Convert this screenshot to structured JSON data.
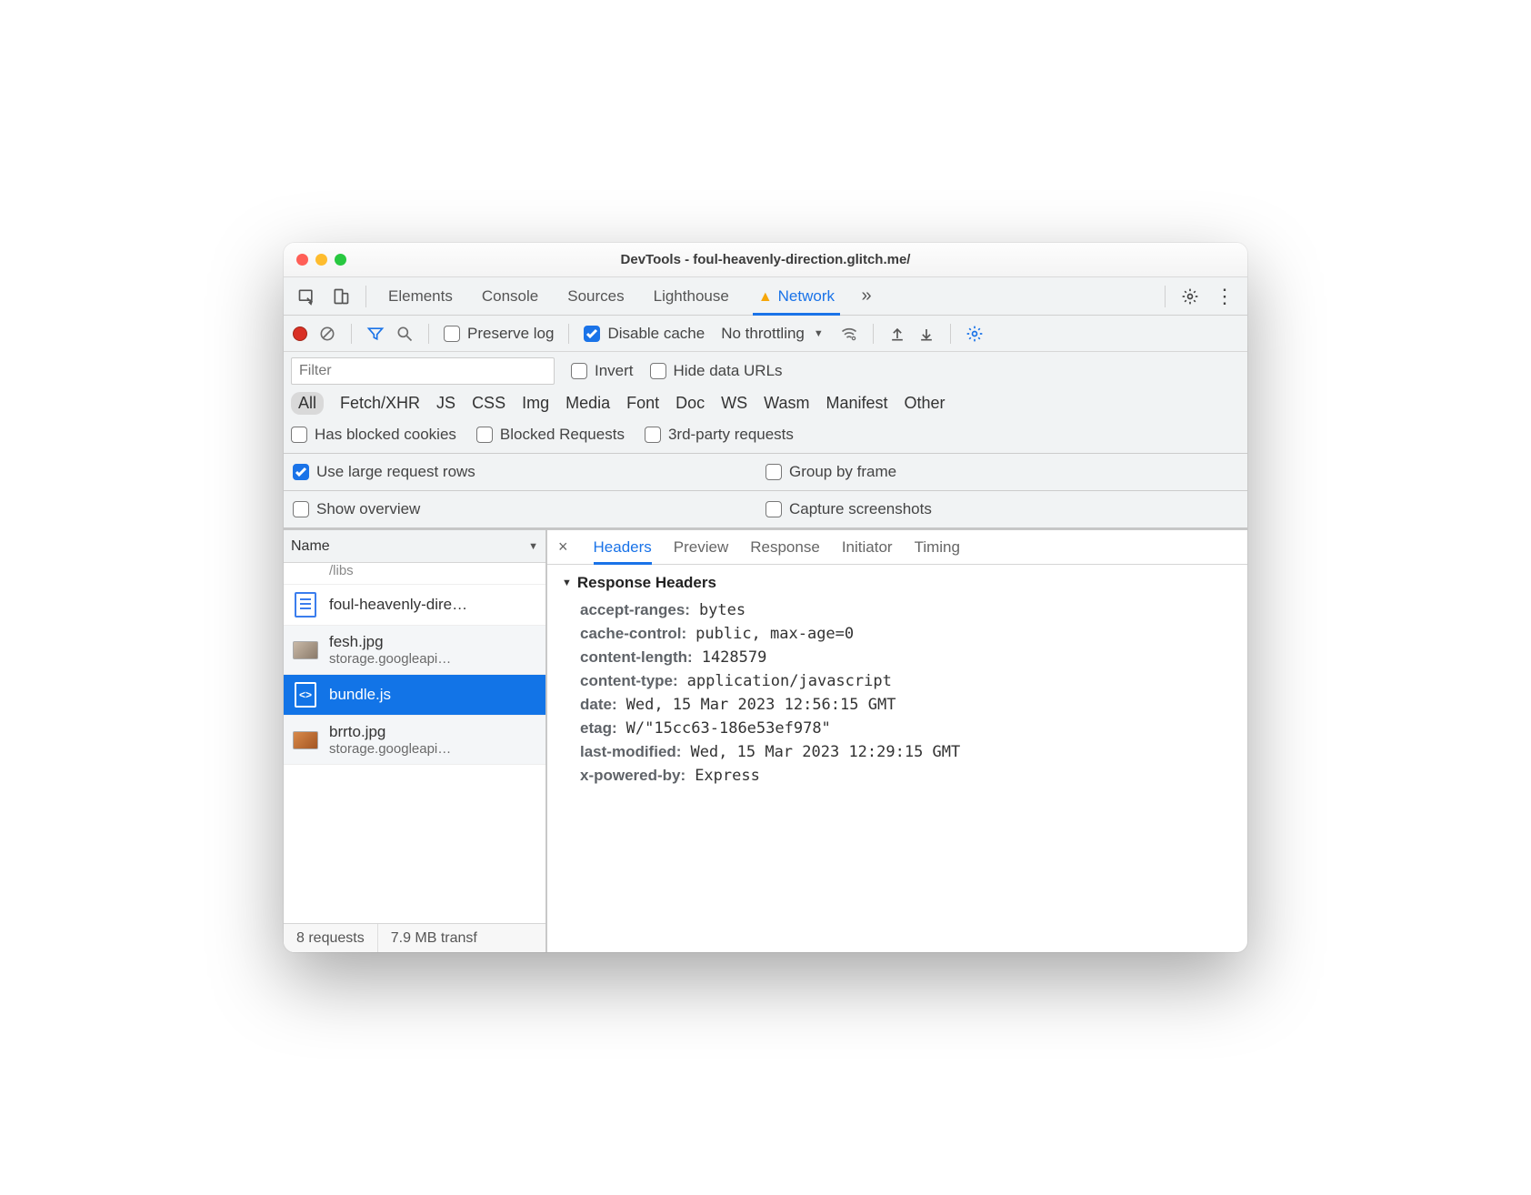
{
  "window": {
    "title": "DevTools - foul-heavenly-direction.glitch.me/"
  },
  "mainTabs": {
    "items": [
      "Elements",
      "Console",
      "Sources",
      "Lighthouse",
      "Network"
    ],
    "active": "Network",
    "hasWarning": true
  },
  "netToolbar": {
    "preserveLog": {
      "label": "Preserve log",
      "checked": false
    },
    "disableCache": {
      "label": "Disable cache",
      "checked": true
    },
    "throttling": {
      "label": "No throttling"
    }
  },
  "filterRow": {
    "placeholder": "Filter",
    "invert": {
      "label": "Invert",
      "checked": false
    },
    "hideData": {
      "label": "Hide data URLs",
      "checked": false
    }
  },
  "typePills": [
    "All",
    "Fetch/XHR",
    "JS",
    "CSS",
    "Img",
    "Media",
    "Font",
    "Doc",
    "WS",
    "Wasm",
    "Manifest",
    "Other"
  ],
  "typePillsActive": "All",
  "extraFilters": {
    "blockedCookies": {
      "label": "Has blocked cookies",
      "checked": false
    },
    "blockedReq": {
      "label": "Blocked Requests",
      "checked": false
    },
    "thirdParty": {
      "label": "3rd-party requests",
      "checked": false
    }
  },
  "settings": {
    "largeRows": {
      "label": "Use large request rows",
      "checked": true
    },
    "groupFrame": {
      "label": "Group by frame",
      "checked": false
    },
    "showOverview": {
      "label": "Show overview",
      "checked": false
    },
    "captureSS": {
      "label": "Capture screenshots",
      "checked": false
    }
  },
  "nameHeader": "Name",
  "partialTop": "/libs",
  "requests": [
    {
      "name": "foul-heavenly-dire…",
      "sub": "",
      "icon": "doc",
      "selected": false,
      "alt": false
    },
    {
      "name": "fesh.jpg",
      "sub": "storage.googleapi…",
      "icon": "imgA",
      "selected": false,
      "alt": true
    },
    {
      "name": "bundle.js",
      "sub": "",
      "icon": "code",
      "selected": true,
      "alt": false
    },
    {
      "name": "brrto.jpg",
      "sub": "storage.googleapi…",
      "icon": "imgB",
      "selected": false,
      "alt": true
    }
  ],
  "detailTabs": [
    "Headers",
    "Preview",
    "Response",
    "Initiator",
    "Timing"
  ],
  "detailTabsActive": "Headers",
  "responseHeaders": {
    "title": "Response Headers",
    "items": [
      {
        "key": "accept-ranges:",
        "val": "bytes"
      },
      {
        "key": "cache-control:",
        "val": "public, max-age=0"
      },
      {
        "key": "content-length:",
        "val": "1428579"
      },
      {
        "key": "content-type:",
        "val": "application/javascript"
      },
      {
        "key": "date:",
        "val": "Wed, 15 Mar 2023 12:56:15 GMT"
      },
      {
        "key": "etag:",
        "val": "W/\"15cc63-186e53ef978\""
      },
      {
        "key": "last-modified:",
        "val": "Wed, 15 Mar 2023 12:29:15 GMT"
      },
      {
        "key": "x-powered-by:",
        "val": "Express"
      }
    ]
  },
  "statusBar": {
    "requests": "8 requests",
    "transfer": "7.9 MB transf"
  }
}
